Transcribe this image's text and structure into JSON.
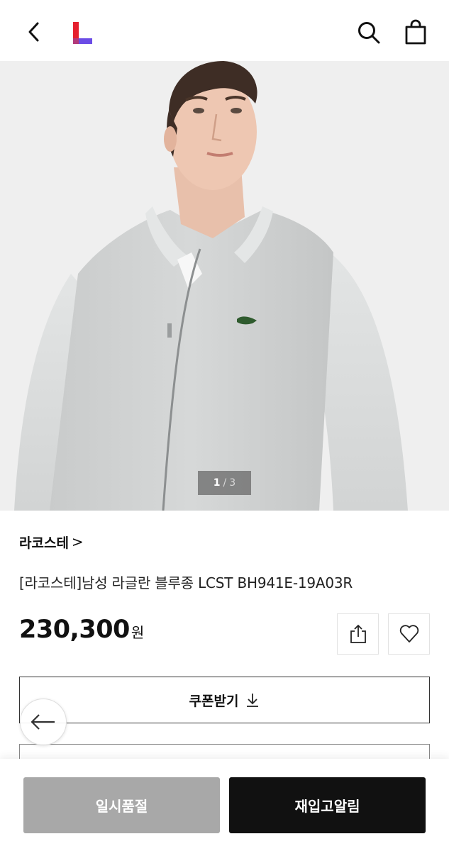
{
  "header": {
    "back_icon": "chevron-left-icon",
    "logo": "L",
    "logo_colors": {
      "red": "#e5202e",
      "purple": "#6b4ce6"
    },
    "search_icon": "search-icon",
    "bag_icon": "shopping-bag-icon"
  },
  "gallery": {
    "current_page": "1",
    "separator": "/",
    "total_pages": "3"
  },
  "product": {
    "brand": "라코스테",
    "brand_chevron": ">",
    "name": "[라코스테]남성 라글란 블루종 LCST BH941E-19A03R",
    "price": "230,300",
    "currency": "원"
  },
  "actions": {
    "share_icon": "share-icon",
    "wish_icon": "heart-icon",
    "coupon_label": "쿠폰받기",
    "coupon_icon": "download-icon",
    "float_back_icon": "arrow-left-icon"
  },
  "bottom": {
    "soldout_label": "일시품절",
    "restock_label": "재입고알림",
    "soldout_color": "#a8a8a8",
    "restock_color": "#111111"
  }
}
